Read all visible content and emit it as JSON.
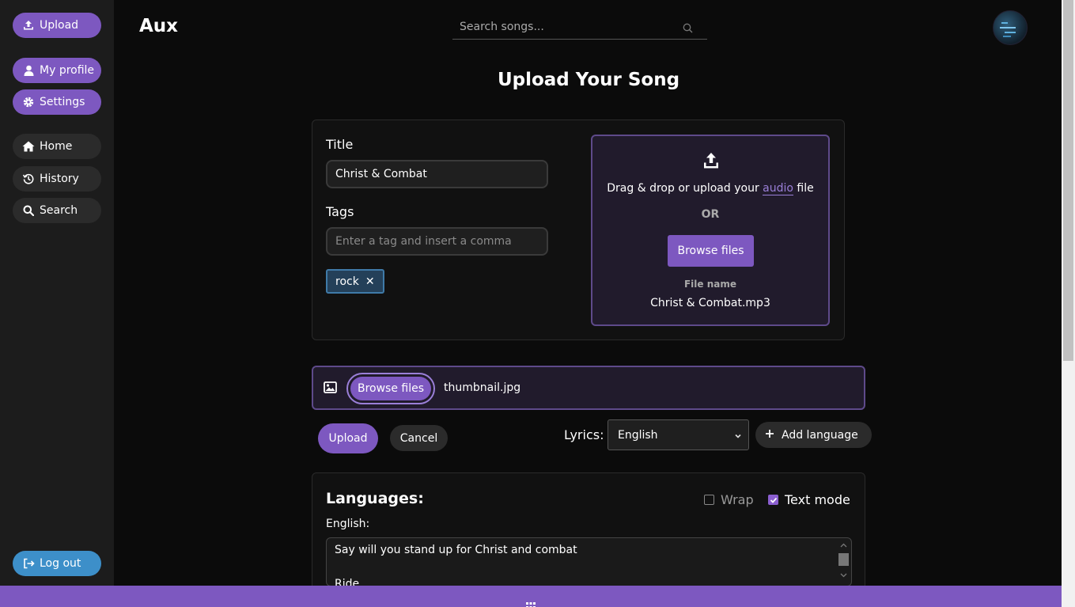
{
  "sidebar": {
    "upload_label": "Upload",
    "profile_label": "My profile",
    "settings_label": "Settings",
    "home_label": "Home",
    "history_label": "History",
    "search_label": "Search",
    "logout_label": "Log out"
  },
  "header": {
    "brand": "Aux",
    "search_placeholder": "Search songs..."
  },
  "page": {
    "title": "Upload Your Song"
  },
  "form": {
    "title_label": "Title",
    "title_value": "Christ & Combat",
    "tags_label": "Tags",
    "tags_placeholder": "Enter a tag and insert a comma",
    "tags": [
      "rock"
    ],
    "tag_remove_glyph": "✕"
  },
  "dropzone": {
    "text_before": "Drag & drop or upload your ",
    "text_accent": "audio",
    "text_after": " file",
    "or_label": "OR",
    "browse_label": "Browse files",
    "file_name_label": "File name",
    "file_name_value": "Christ & Combat.mp3"
  },
  "thumbnail": {
    "browse_label": "Browse files",
    "file_name": "thumbnail.jpg"
  },
  "actions": {
    "upload_label": "Upload",
    "cancel_label": "Cancel",
    "lyrics_label": "Lyrics:",
    "language_selected": "English",
    "add_language_label": "Add language"
  },
  "languages": {
    "title": "Languages:",
    "wrap_label": "Wrap",
    "wrap_checked": false,
    "text_mode_label": "Text mode",
    "text_mode_checked": true,
    "english_label": "English:",
    "lyrics_lines": [
      "Say will you stand up for Christ and combat",
      "",
      "Ride"
    ]
  },
  "colors": {
    "accent": "#7d58c0",
    "sidebar": "#1c1c1c",
    "logout": "#3d8fc9",
    "tag_bg": "#244059"
  }
}
